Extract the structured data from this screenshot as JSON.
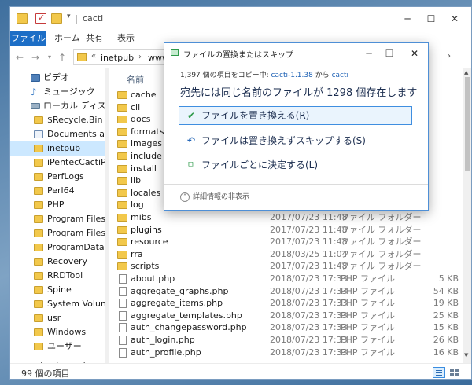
{
  "window": {
    "title": "cacti"
  },
  "ribbon": {
    "tabs": [
      "ファイル",
      "ホーム",
      "共有",
      "表示"
    ]
  },
  "address": {
    "chevron": "«",
    "parts": [
      "inetpub",
      "wwwroot"
    ]
  },
  "nav": {
    "items": [
      {
        "label": "ビデオ",
        "icon": "video-icon"
      },
      {
        "label": "ミュージック",
        "icon": "music-icon"
      },
      {
        "label": "ローカル ディスク (C",
        "icon": "drive-icon"
      },
      {
        "label": "$Recycle.Bin",
        "icon": "folder-icon"
      },
      {
        "label": "Documents and",
        "icon": "document-icon"
      },
      {
        "label": "inetpub",
        "icon": "folder-icon",
        "selected": true
      },
      {
        "label": "iPentecCactiPo",
        "icon": "folder-icon"
      },
      {
        "label": "PerfLogs",
        "icon": "folder-icon"
      },
      {
        "label": "Perl64",
        "icon": "folder-icon"
      },
      {
        "label": "PHP",
        "icon": "folder-icon"
      },
      {
        "label": "Program Files",
        "icon": "folder-icon"
      },
      {
        "label": "Program Files (",
        "icon": "folder-icon"
      },
      {
        "label": "ProgramData",
        "icon": "folder-icon"
      },
      {
        "label": "Recovery",
        "icon": "folder-icon"
      },
      {
        "label": "RRDTool",
        "icon": "folder-icon"
      },
      {
        "label": "Spine",
        "icon": "folder-icon"
      },
      {
        "label": "System Volume",
        "icon": "folder-icon"
      },
      {
        "label": "usr",
        "icon": "folder-icon"
      },
      {
        "label": "Windows",
        "icon": "folder-icon"
      },
      {
        "label": "ユーザー",
        "icon": "folder-icon"
      }
    ],
    "network": "ネットワーク"
  },
  "files": {
    "column_name": "名前",
    "rows": [
      {
        "name": "cache",
        "kind": "folder",
        "date": "",
        "type": "",
        "size": ""
      },
      {
        "name": "cli",
        "kind": "folder",
        "date": "",
        "type": "",
        "size": ""
      },
      {
        "name": "docs",
        "kind": "folder",
        "date": "",
        "type": "",
        "size": ""
      },
      {
        "name": "formats",
        "kind": "folder",
        "date": "",
        "type": "",
        "size": ""
      },
      {
        "name": "images",
        "kind": "folder",
        "date": "",
        "type": "",
        "size": ""
      },
      {
        "name": "include",
        "kind": "folder",
        "date": "",
        "type": "",
        "size": ""
      },
      {
        "name": "install",
        "kind": "folder",
        "date": "",
        "type": "",
        "size": ""
      },
      {
        "name": "lib",
        "kind": "folder",
        "date": "",
        "type": "",
        "size": ""
      },
      {
        "name": "locales",
        "kind": "folder",
        "date": "",
        "type": "",
        "size": ""
      },
      {
        "name": "log",
        "kind": "folder",
        "date": "",
        "type": "",
        "size": ""
      },
      {
        "name": "mibs",
        "kind": "folder",
        "date": "2017/07/23 11:48",
        "type": "ファイル フォルダー",
        "size": ""
      },
      {
        "name": "plugins",
        "kind": "folder",
        "date": "2017/07/23 11:48",
        "type": "ファイル フォルダー",
        "size": ""
      },
      {
        "name": "resource",
        "kind": "folder",
        "date": "2017/07/23 11:48",
        "type": "ファイル フォルダー",
        "size": ""
      },
      {
        "name": "rra",
        "kind": "folder",
        "date": "2018/03/25 11:04",
        "type": "ファイル フォルダー",
        "size": ""
      },
      {
        "name": "scripts",
        "kind": "folder",
        "date": "2017/07/23 11:48",
        "type": "ファイル フォルダー",
        "size": ""
      },
      {
        "name": "about.php",
        "kind": "file",
        "date": "2018/07/23 17:33",
        "type": "PHP ファイル",
        "size": "5 KB"
      },
      {
        "name": "aggregate_graphs.php",
        "kind": "file",
        "date": "2018/07/23 17:33",
        "type": "PHP ファイル",
        "size": "54 KB"
      },
      {
        "name": "aggregate_items.php",
        "kind": "file",
        "date": "2018/07/23 17:33",
        "type": "PHP ファイル",
        "size": "19 KB"
      },
      {
        "name": "aggregate_templates.php",
        "kind": "file",
        "date": "2018/07/23 17:33",
        "type": "PHP ファイル",
        "size": "25 KB"
      },
      {
        "name": "auth_changepassword.php",
        "kind": "file",
        "date": "2018/07/23 17:33",
        "type": "PHP ファイル",
        "size": "15 KB"
      },
      {
        "name": "auth_login.php",
        "kind": "file",
        "date": "2018/07/23 17:33",
        "type": "PHP ファイル",
        "size": "26 KB"
      },
      {
        "name": "auth_profile.php",
        "kind": "file",
        "date": "2018/07/23 17:33",
        "type": "PHP ファイル",
        "size": "16 KB"
      }
    ]
  },
  "status": {
    "count": "99 個の項目"
  },
  "dialog": {
    "title": "ファイルの置換またはスキップ",
    "info_prefix": "1,397 個の項目をコピー中: ",
    "source": "cacti-1.1.38",
    "info_mid": " から ",
    "destination": "cacti",
    "heading": "宛先には同じ名前のファイルが 1298 個存在します",
    "option_replace": "ファイルを置き換える(R)",
    "option_skip": "ファイルは置き換えずスキップする(S)",
    "option_decide": "ファイルごとに決定する(L)",
    "details": "詳細情報の非表示"
  },
  "colors": {
    "accent": "#1c6ec6",
    "dialog_border": "#4e8fd6",
    "selection": "#cce8ff",
    "folder": "#f2c84b"
  }
}
